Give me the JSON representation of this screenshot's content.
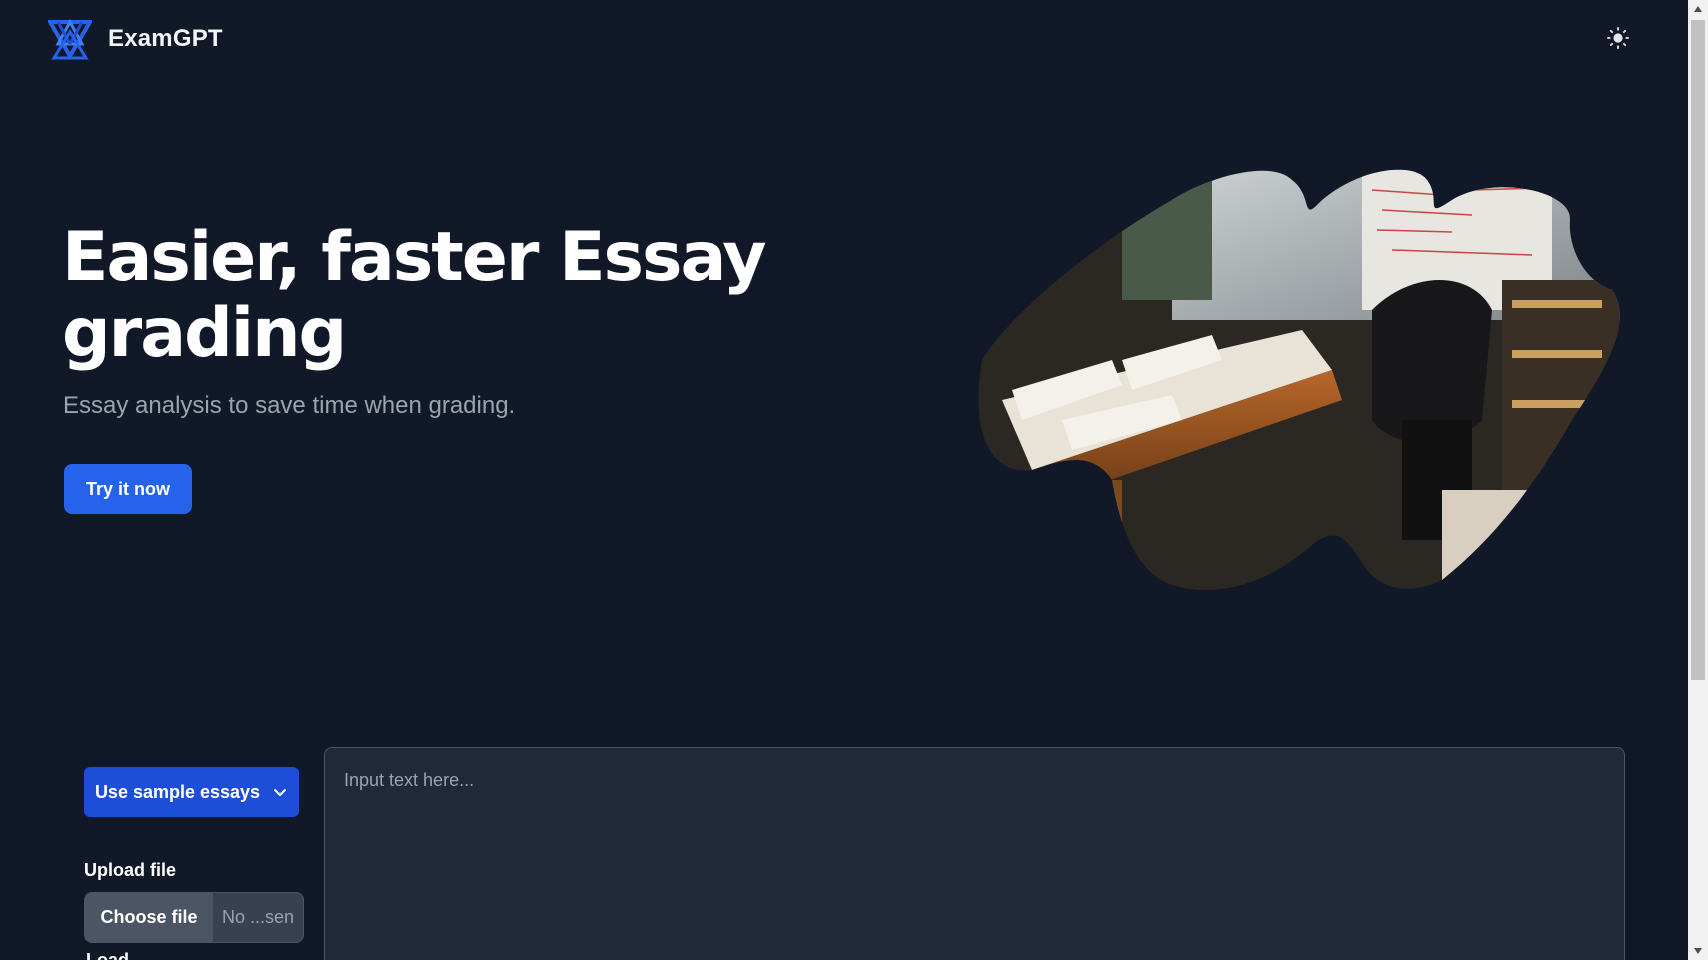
{
  "header": {
    "brand_name": "ExamGPT",
    "logo_icon": "star-triangle-logo",
    "theme_toggle_icon": "sun-icon"
  },
  "hero": {
    "title_line1": "Easier, faster Essay",
    "title_line2": "grading",
    "subtitle": "Essay analysis to save time when grading.",
    "cta_label": "Try it now"
  },
  "tool": {
    "sample_button_label": "Use sample essays",
    "upload_label": "Upload file",
    "choose_file_label": "Choose file",
    "file_status": "No ...sen",
    "input_placeholder": "Input text here...",
    "cut_label": "Load"
  },
  "colors": {
    "background": "#111827",
    "accent": "#2563eb",
    "input_bg": "#1f2937"
  }
}
